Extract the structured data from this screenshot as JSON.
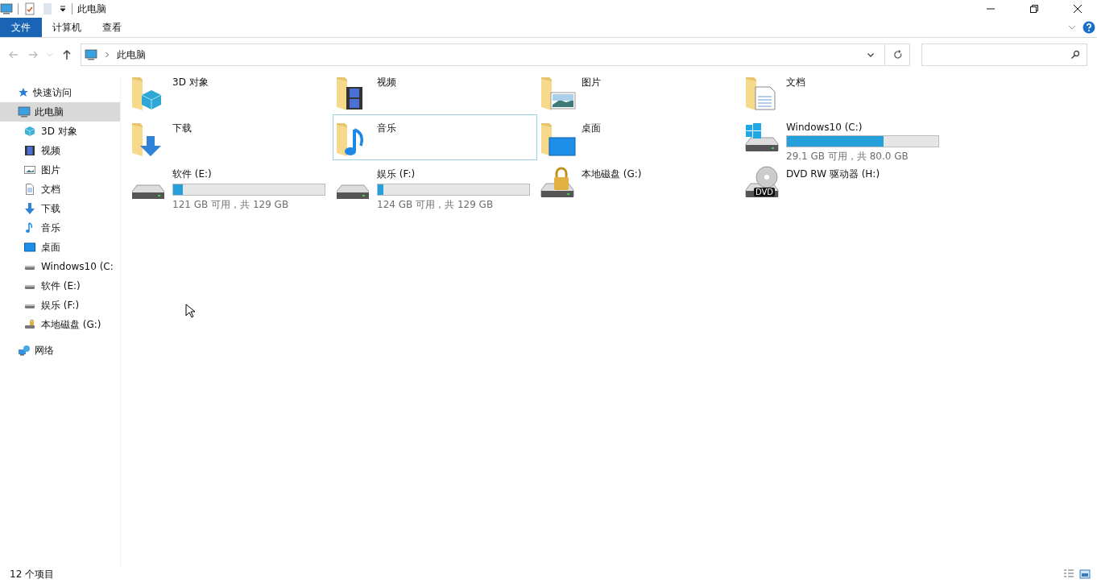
{
  "window": {
    "title": "此电脑"
  },
  "ribbon_tabs": [
    {
      "label": "文件",
      "kind": "file"
    },
    {
      "label": "计算机",
      "kind": "tab"
    },
    {
      "label": "查看",
      "kind": "tab"
    }
  ],
  "address_bar": {
    "path": "此电脑"
  },
  "sidebar": {
    "items": [
      {
        "label": "快速访问",
        "kind": "star",
        "selected": false
      },
      {
        "label": "此电脑",
        "kind": "pc",
        "selected": true,
        "children": [
          {
            "label": "3D 对象",
            "kind": "cube",
            "selected": false
          },
          {
            "label": "视频",
            "kind": "film",
            "selected": false
          },
          {
            "label": "图片",
            "kind": "picture",
            "selected": false
          },
          {
            "label": "文档",
            "kind": "document",
            "selected": false
          },
          {
            "label": "下载",
            "kind": "download",
            "selected": false
          },
          {
            "label": "音乐",
            "kind": "music",
            "selected": false
          },
          {
            "label": "桌面",
            "kind": "desktop",
            "selected": false
          },
          {
            "label": "Windows10 (C:",
            "kind": "drive",
            "selected": false
          },
          {
            "label": "软件 (E:)",
            "kind": "drive",
            "selected": false
          },
          {
            "label": "娱乐 (F:)",
            "kind": "drive",
            "selected": false
          },
          {
            "label": "本地磁盘 (G:)",
            "kind": "locked-drive",
            "selected": false
          }
        ]
      },
      {
        "label": "网络",
        "kind": "network",
        "selected": false
      }
    ]
  },
  "items": [
    {
      "name": "3D 对象",
      "kind": "cube",
      "selected": false
    },
    {
      "name": "视频",
      "kind": "film",
      "selected": false
    },
    {
      "name": "图片",
      "kind": "picture",
      "selected": false
    },
    {
      "name": "文档",
      "kind": "document",
      "selected": false
    },
    {
      "name": "下载",
      "kind": "download",
      "selected": false
    },
    {
      "name": "音乐",
      "kind": "music",
      "selected": true
    },
    {
      "name": "桌面",
      "kind": "desktop",
      "selected": false
    },
    {
      "name": "Windows10 (C:)",
      "kind": "windows",
      "selected": false,
      "level": 0.636,
      "space": "29.1 GB 可用，共 80.0 GB"
    },
    {
      "name": "软件 (E:)",
      "kind": "drive",
      "selected": false,
      "level": 0.062,
      "space": "121 GB 可用，共 129 GB"
    },
    {
      "name": "娱乐 (F:)",
      "kind": "drive",
      "selected": false,
      "level": 0.039,
      "space": "124 GB 可用，共 129 GB"
    },
    {
      "name": "本地磁盘 (G:)",
      "kind": "lock",
      "selected": false
    },
    {
      "name": "DVD RW 驱动器 (H:)",
      "kind": "dvd",
      "selected": false,
      "dvd_label": "DVD"
    }
  ],
  "status_bar": {
    "count": "12 个项目"
  }
}
